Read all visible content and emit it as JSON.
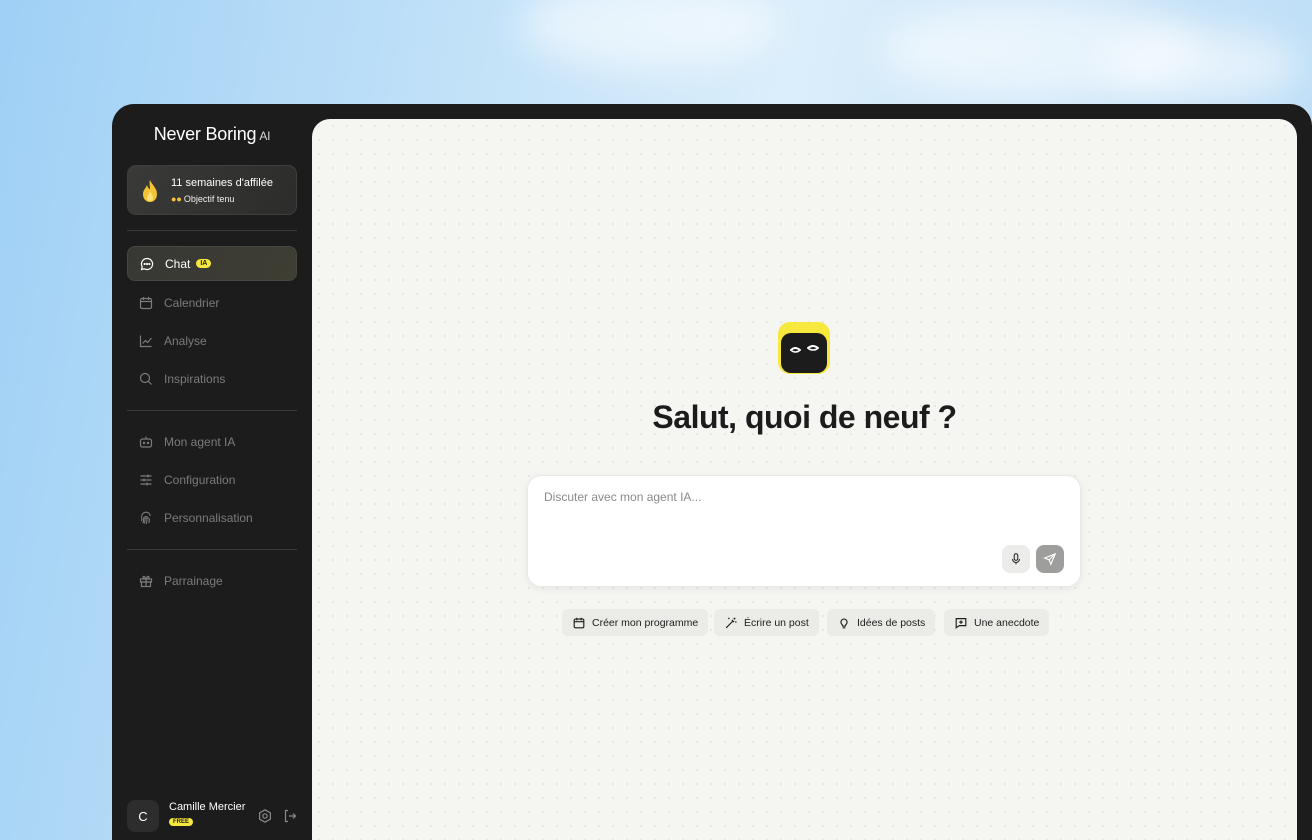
{
  "brand": {
    "name": "Never Boring",
    "suffix": "AI"
  },
  "streak": {
    "title": "11 semaines d'affilée",
    "subtitle": "Objectif tenu"
  },
  "nav": {
    "chat": {
      "label": "Chat",
      "badge": "IA"
    },
    "calendar": "Calendrier",
    "analyse": "Analyse",
    "inspirations": "Inspirations",
    "agent": "Mon agent IA",
    "configuration": "Configuration",
    "personnalisation": "Personnalisation",
    "parrainage": "Parrainage"
  },
  "user": {
    "initial": "C",
    "name": "Camille Mercier",
    "plan": "FREE"
  },
  "main": {
    "greeting": "Salut, quoi de neuf ?",
    "input_placeholder": "Discuter avec mon agent IA..."
  },
  "chips": {
    "programme": "Créer mon programme",
    "post": "Écrire un post",
    "ideas": "Idées de posts",
    "anecdote": "Une anecdote"
  },
  "colors": {
    "accent": "#f6e83c",
    "sidebar": "#1c1c1c",
    "main_bg": "#f5f5f2"
  }
}
